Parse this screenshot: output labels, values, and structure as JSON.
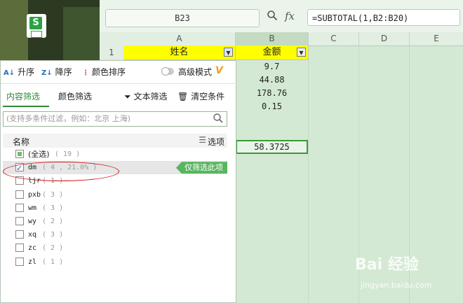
{
  "spreadsheet": {
    "name_box": "B23",
    "fx_label": "fx",
    "formula": "=SUBTOTAL(1,B2:B20)",
    "columns": [
      "A",
      "B",
      "C",
      "D",
      "E"
    ],
    "row_number": "1",
    "header_a": "姓名",
    "header_b": "金额",
    "values": [
      "9.7",
      "44.88",
      "178.76",
      "0.15"
    ],
    "result": "58.3725"
  },
  "filter_panel": {
    "sort_asc": "升序",
    "sort_desc": "降序",
    "color_sort": "颜色排序",
    "advanced_mode": "高级模式",
    "tabs": [
      "内容筛选",
      "颜色筛选"
    ],
    "text_filter": "文本筛选",
    "clear": "清空条件",
    "search_placeholder": "(支持多条件过滤，例如：北京 上海)",
    "list_header_name": "名称",
    "list_header_options": "选项",
    "only_filter_label": "仅筛选此项",
    "items": [
      {
        "name": "(全选)",
        "count": "( 19 )",
        "state": "partial"
      },
      {
        "name": "dm",
        "count": "( 4 , 21.0% )",
        "state": "checked"
      },
      {
        "name": "ljr",
        "count": "( 1 )",
        "state": "unchecked"
      },
      {
        "name": "pxb",
        "count": "( 3 )",
        "state": "unchecked"
      },
      {
        "name": "wm",
        "count": "( 3 )",
        "state": "unchecked"
      },
      {
        "name": "wy",
        "count": "( 2 )",
        "state": "unchecked"
      },
      {
        "name": "xq",
        "count": "( 3 )",
        "state": "unchecked"
      },
      {
        "name": "zc",
        "count": "( 2 )",
        "state": "unchecked"
      },
      {
        "name": "zl",
        "count": "( 1 )",
        "state": "unchecked"
      }
    ]
  },
  "watermark": {
    "main": "Bai 经验",
    "url": "jingyan.baidu.com"
  },
  "colors": {
    "header_fill": "#ffff00",
    "accent_green": "#2f8a36",
    "annotation_red": "#d01818"
  }
}
